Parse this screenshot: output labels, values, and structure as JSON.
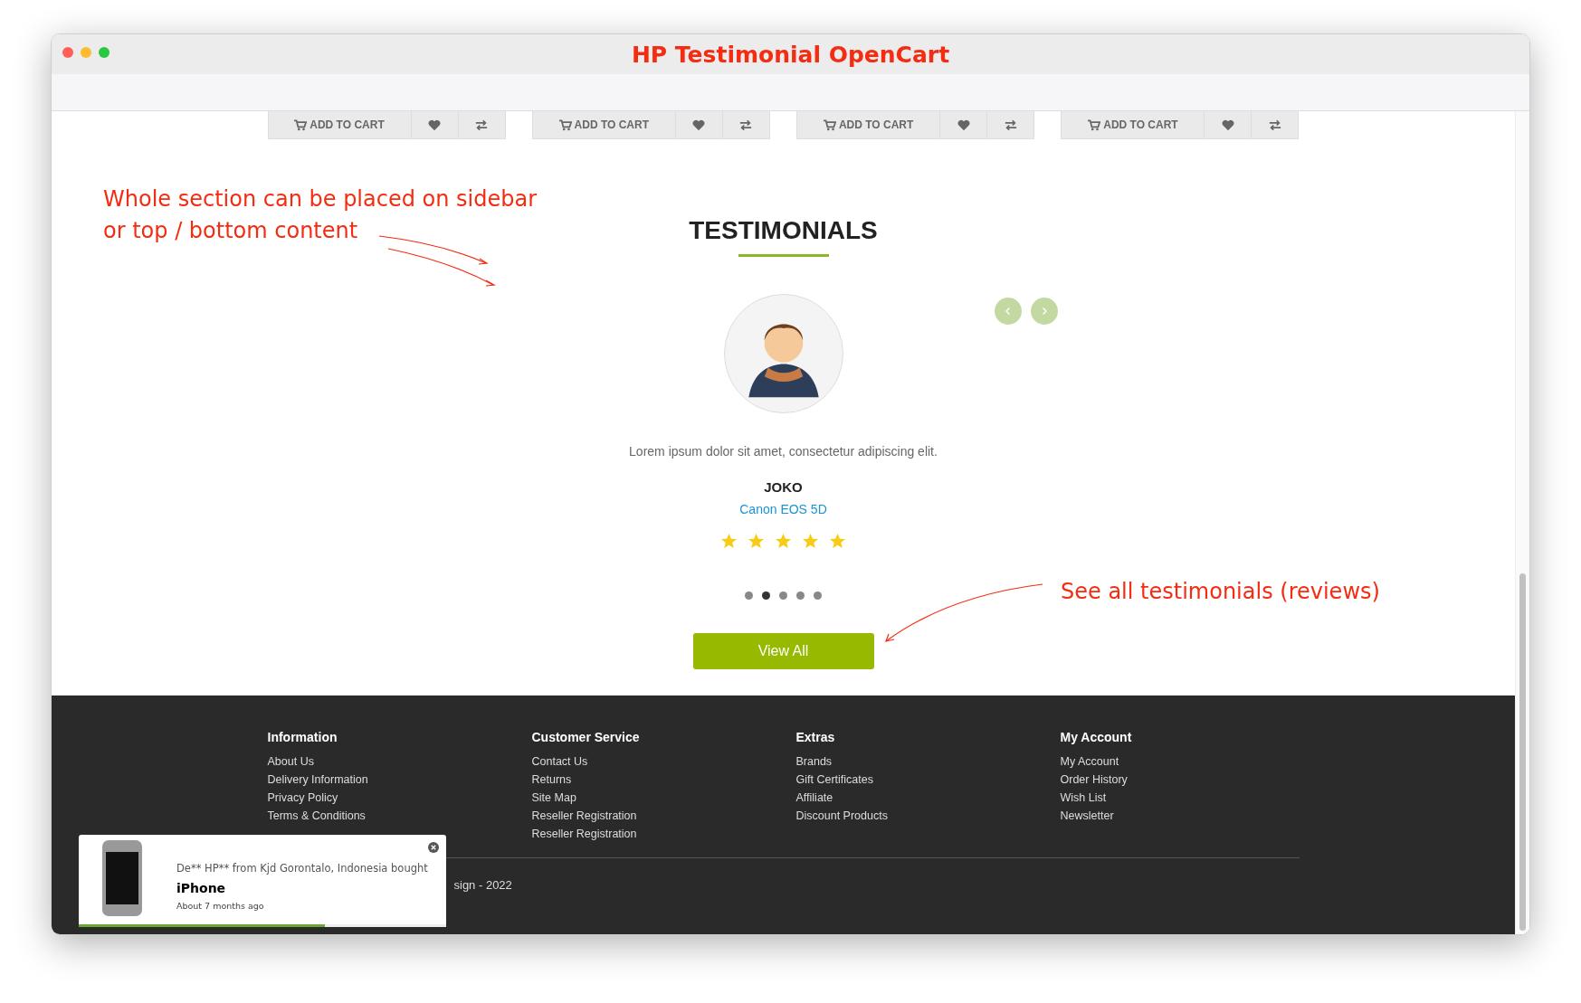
{
  "window": {
    "title": "HP Testimonial OpenCart"
  },
  "product_actions": [
    {
      "add_to_cart": "ADD TO CART"
    },
    {
      "add_to_cart": "ADD TO CART"
    },
    {
      "add_to_cart": "ADD TO CART"
    },
    {
      "add_to_cart": "ADD TO CART"
    }
  ],
  "annotations": [
    {
      "kind": "section",
      "text": "Whole section can be placed on sidebar or top / bottom content"
    },
    {
      "kind": "view_all",
      "text": "See all testimonials (reviews)"
    }
  ],
  "testimonials": {
    "title": "TESTIMONIALS",
    "quote": "Lorem ipsum dolor sit amet, consectetur adipiscing elit.",
    "name": "JOKO",
    "product": "Canon EOS 5D",
    "stars": 5,
    "pages": [
      {
        "selected": false
      },
      {
        "selected": true
      },
      {
        "selected": false
      },
      {
        "selected": false
      },
      {
        "selected": false
      }
    ],
    "button": "View All"
  },
  "footer": {
    "columns": [
      {
        "heading": "Information",
        "links": [
          "About Us",
          "Delivery Information",
          "Privacy Policy",
          "Terms & Conditions"
        ]
      },
      {
        "heading": "Customer Service",
        "links": [
          "Contact Us",
          "Returns",
          "Site Map",
          "Reseller Registration",
          "Reseller Registration"
        ]
      },
      {
        "heading": "Extras",
        "links": [
          "Brands",
          "Gift Certificates",
          "Affiliate",
          "Discount Products"
        ]
      },
      {
        "heading": "My Account",
        "links": [
          "My Account",
          "Order History",
          "Wish List",
          "Newsletter"
        ]
      }
    ],
    "copyright": "sign - 2022"
  },
  "purchase_popup": {
    "message": "De** HP** from Kjd Gorontalo, Indonesia bought",
    "product": "iPhone",
    "time": "About 7 months ago",
    "level": 0.67
  }
}
